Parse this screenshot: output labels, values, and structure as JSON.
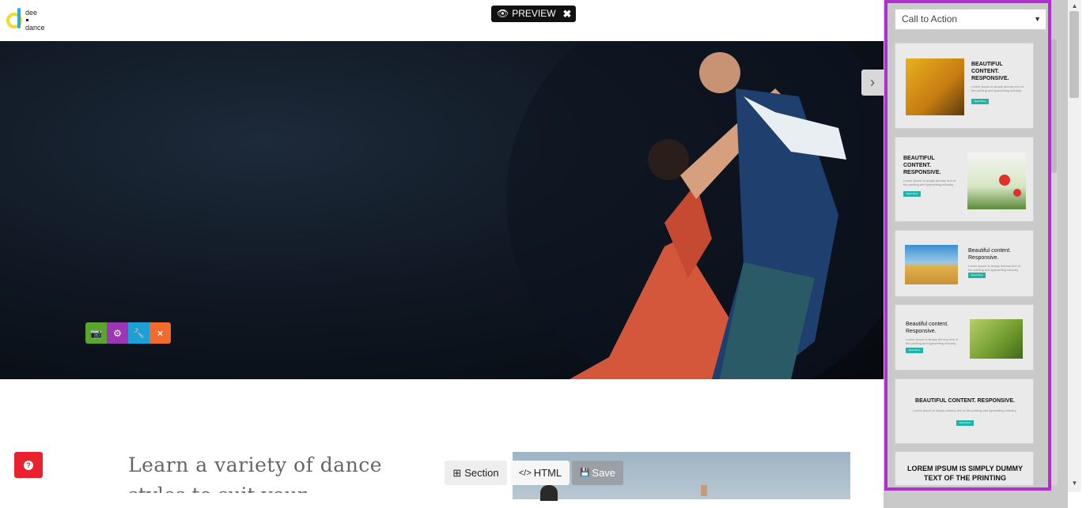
{
  "logo": {
    "line1": "dee",
    "line2": "dance"
  },
  "topbar": {
    "preview_label": "PREVIEW",
    "close_label": "✖"
  },
  "hero": {
    "tools": {
      "camera_icon": "📷",
      "settings_icon": "⚙",
      "wrench_icon": "🔧",
      "remove_icon": "×"
    },
    "next_arrow": "›"
  },
  "help": {
    "icon": "?"
  },
  "content": {
    "heading": "Learn a variety of dance",
    "heading_line2": "styles to suit your favourite"
  },
  "toolbar": {
    "section_label": "Section",
    "html_label": "HTML",
    "save_label": "Save",
    "section_icon": "⊞",
    "html_icon": "</>",
    "save_icon": "💾"
  },
  "panel": {
    "category_selected": "Call to Action",
    "thumbnails": [
      {
        "title": "BEAUTIFUL CONTENT. RESPONSIVE.",
        "lorem": "Lorem Ipsum is simply dummy text of the printing and typesetting industry.",
        "button": "Read More"
      },
      {
        "title": "BEAUTIFUL CONTENT. RESPONSIVE.",
        "lorem": "Lorem Ipsum is simply dummy text of the printing and typesetting industry.",
        "button": "Read More"
      },
      {
        "title": "Beautiful content. Responsive.",
        "lorem": "Lorem Ipsum is simply dummy text of the printing and typesetting industry.",
        "button": "Read More"
      },
      {
        "title": "Beautiful content. Responsive.",
        "lorem": "Lorem Ipsum is simply dummy text of the printing and typesetting industry.",
        "button": "Read More"
      },
      {
        "title": "BEAUTIFUL CONTENT. RESPONSIVE.",
        "lorem": "Lorem Ipsum is simply dummy text of the printing and typesetting industry.",
        "button": "Read More"
      },
      {
        "title": "LOREM IPSUM IS SIMPLY DUMMY TEXT OF THE PRINTING"
      }
    ]
  },
  "colors": {
    "accent_outline": "#b12fd0",
    "teal_button": "#1fb3a8",
    "help_red": "#e8232f"
  }
}
